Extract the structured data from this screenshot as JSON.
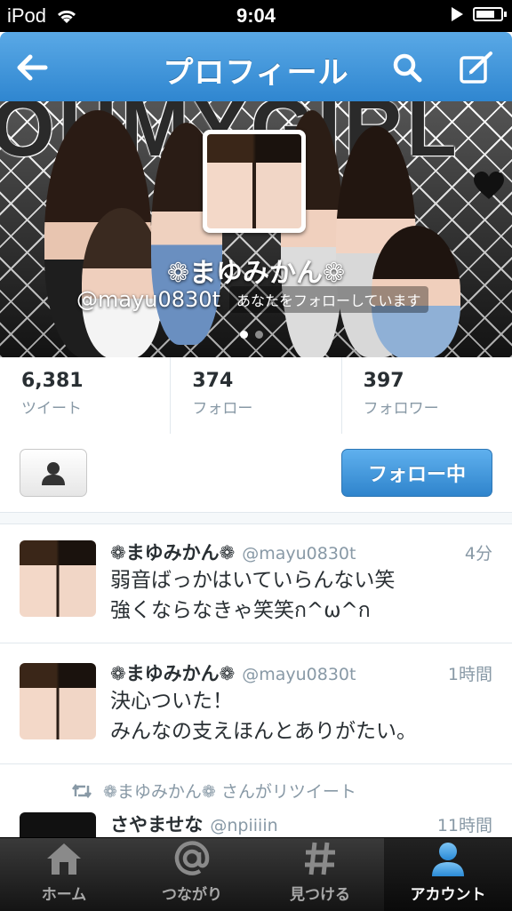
{
  "status_bar": {
    "carrier": "iPod",
    "time": "9:04",
    "battery_level": 0.75
  },
  "nav": {
    "title": "プロフィール",
    "back_icon": "back-arrow-icon",
    "search_icon": "search-icon",
    "compose_icon": "compose-icon"
  },
  "header": {
    "banner_text": "OHMYGIRL",
    "name": "❁まゆみかん❁",
    "handle": "@mayu0830t",
    "follows_you": "あなたをフォローしています",
    "page_count": 2,
    "active_page": 1
  },
  "stats": [
    {
      "value": "6,381",
      "label": "ツイート"
    },
    {
      "value": "374",
      "label": "フォロー"
    },
    {
      "value": "397",
      "label": "フォロワー"
    }
  ],
  "actions": {
    "user_menu_icon": "person-icon",
    "follow_label": "フォロー中"
  },
  "tweets": [
    {
      "name": "❁まゆみかん❁",
      "handle": "@mayu0830t",
      "time": "4分",
      "line1": "弱音ばっかはいていらんない笑",
      "line2": "強くならなきゃ笑笑ก^ω^ก"
    },
    {
      "name": "❁まゆみかん❁",
      "handle": "@mayu0830t",
      "time": "1時間",
      "line1": "決心ついた！",
      "line2": "みんなの支えほんとありがたい。"
    }
  ],
  "retweet": {
    "notice": "❁まゆみかん❁ さんがリツイート",
    "name": "さやませな",
    "handle": "@npiiiin",
    "time": "11時間"
  },
  "tabs": [
    {
      "label": "ホーム",
      "icon": "home-icon",
      "active": false
    },
    {
      "label": "つながり",
      "icon": "at-icon",
      "active": false
    },
    {
      "label": "見つける",
      "icon": "hash-icon",
      "active": false
    },
    {
      "label": "アカウント",
      "icon": "account-icon",
      "active": true
    }
  ],
  "colors": {
    "accent": "#2f86d0",
    "muted": "#8899a6"
  }
}
